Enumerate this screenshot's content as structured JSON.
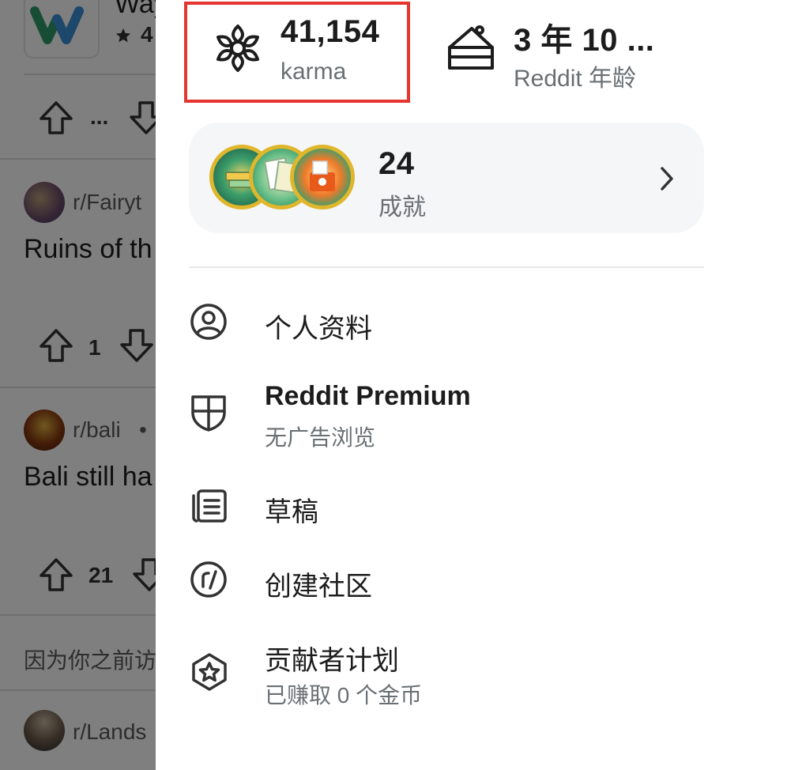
{
  "feed": {
    "top_post_title_fragment": "Way",
    "top_post_rating_fragment": "4",
    "posts": [
      {
        "subreddit": "r/Fairyt",
        "title": "Ruins of th",
        "upvotes": "1"
      },
      {
        "subreddit": "r/bali",
        "subreddit_dot": "•",
        "title": "Bali still ha",
        "upvotes": "21"
      }
    ],
    "recommendation_note": "因为你之前访",
    "next_subreddit": "r/Lands",
    "top_vote_ellipsis": "..."
  },
  "drawer": {
    "stats": {
      "karma": {
        "value": "41,154",
        "label": "karma",
        "icon": "karma-flower-icon"
      },
      "age": {
        "value": "3 年 10 ...",
        "label": "Reddit 年龄",
        "icon": "cake-icon"
      }
    },
    "achievements": {
      "count": "24",
      "label": "成就"
    },
    "menu": [
      {
        "label": "个人资料",
        "icon": "profile-icon"
      },
      {
        "label": "Reddit Premium",
        "sublabel": "无广告浏览",
        "icon": "premium-shield-icon"
      },
      {
        "label": "草稿",
        "icon": "drafts-icon"
      },
      {
        "label": "创建社区",
        "icon": "create-community-icon"
      },
      {
        "label": "贡献者计划",
        "sublabel": "已赚取 0 个金币",
        "icon": "contributor-program-icon"
      }
    ]
  },
  "colors": {
    "highlight_border": "#e5352f",
    "badge_ring": "#e0b62c",
    "card_background": "#f5f6f7",
    "text_primary": "#1c1c1c",
    "text_secondary": "#6a6f73"
  }
}
